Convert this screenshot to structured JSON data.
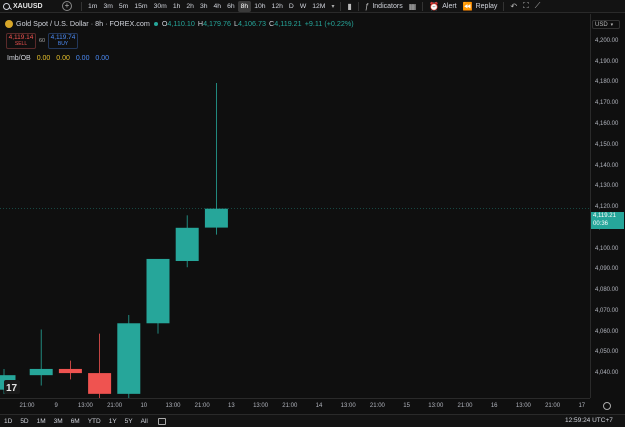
{
  "toolbar": {
    "symbol": "XAUUSD",
    "intervals": [
      "1m",
      "3m",
      "5m",
      "15m",
      "30m",
      "1h",
      "2h",
      "3h",
      "4h",
      "6h",
      "8h",
      "10h",
      "12h",
      "D",
      "W",
      "12M"
    ],
    "active_interval": "8h",
    "indicators_label": "Indicators",
    "alert_label": "Alert",
    "replay_label": "Replay"
  },
  "legend": {
    "title": "Gold Spot / U.S. Dollar · 8h · FOREX.com",
    "open_key": "O",
    "open": "4,110.10",
    "high_key": "H",
    "high": "4,179.76",
    "low_key": "L",
    "low": "4,106.73",
    "close_key": "C",
    "close": "4,119.21",
    "change": "+9.11 (+0.22%)"
  },
  "trade": {
    "sell_price": "4,119.14",
    "sell_label": "SELL",
    "spread": "60",
    "buy_price": "4,119.74",
    "buy_label": "BUY"
  },
  "indicator": {
    "name": "Imb/OB",
    "values": [
      "0.00",
      "0.00",
      "0.00",
      "0.00"
    ]
  },
  "price_axis": {
    "currency": "USD",
    "last_price": "4,119.21",
    "countdown": "00:36"
  },
  "bottom": {
    "ranges": [
      "1D",
      "5D",
      "1M",
      "3M",
      "6M",
      "YTD",
      "1Y",
      "5Y",
      "All"
    ],
    "clock": "12:59:24 UTC+7"
  },
  "colors": {
    "up": "#26a69a",
    "down": "#ef5350",
    "background": "#0f0f0f"
  },
  "chart_data": {
    "type": "candlestick",
    "y_ticks": [
      4040,
      4050,
      4060,
      4070,
      4080,
      4090,
      4100,
      4110,
      4120,
      4130,
      4140,
      4150,
      4160,
      4170,
      4180,
      4190,
      4200
    ],
    "ylim": [
      4028,
      4213
    ],
    "x_ticks": [
      "21:00",
      "9",
      "13:00",
      "21:00",
      "10",
      "13:00",
      "21:00",
      "13",
      "13:00",
      "21:00",
      "14",
      "13:00",
      "21:00",
      "15",
      "13:00",
      "21:00",
      "16",
      "13:00",
      "21:00",
      "17"
    ],
    "candles": [
      {
        "o": 4032,
        "h": 4042,
        "l": 4030,
        "c": 4039
      },
      {
        "o": 4039,
        "h": 4061,
        "l": 4034,
        "c": 4042
      },
      {
        "o": 4042,
        "h": 4046,
        "l": 4037,
        "c": 4040
      },
      {
        "o": 4040,
        "h": 4059,
        "l": 4028,
        "c": 4030
      },
      {
        "o": 4030,
        "h": 4068,
        "l": 4028,
        "c": 4064
      },
      {
        "o": 4064,
        "h": 4078,
        "l": 4059,
        "c": 4095
      },
      {
        "o": 4094,
        "h": 4116,
        "l": 4091,
        "c": 4110
      },
      {
        "o": 4110.1,
        "h": 4179.76,
        "l": 4106.73,
        "c": 4119.21
      }
    ],
    "last_price": 4119.21
  }
}
